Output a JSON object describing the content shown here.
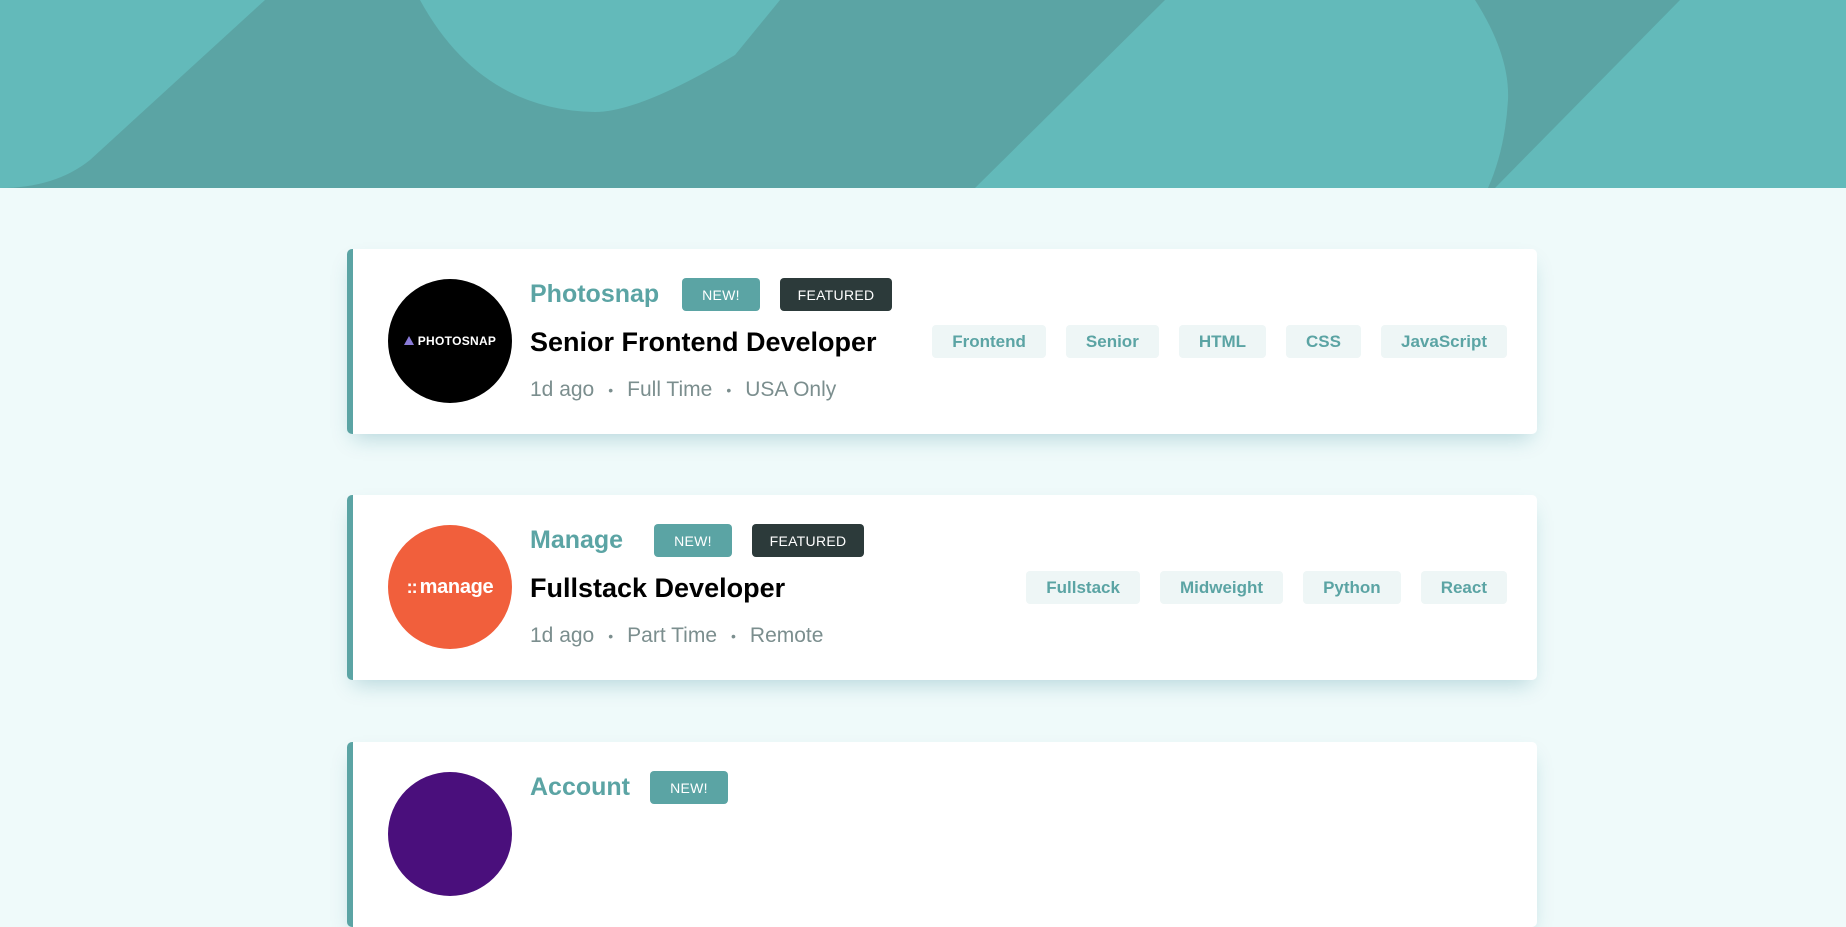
{
  "jobs": [
    {
      "company": "Photosnap",
      "logo_text": "PHOTOSNAP",
      "logo_color": "#000000",
      "new_label": "NEW!",
      "featured_label": "FEATURED",
      "position": "Senior Frontend Developer",
      "posted": "1d ago",
      "contract": "Full Time",
      "location": "USA Only",
      "tags": [
        "Frontend",
        "Senior",
        "HTML",
        "CSS",
        "JavaScript"
      ]
    },
    {
      "company": "Manage",
      "logo_text": "manage",
      "logo_color": "#f15f3c",
      "new_label": "NEW!",
      "featured_label": "FEATURED",
      "position": "Fullstack Developer",
      "posted": "1d ago",
      "contract": "Part Time",
      "location": "Remote",
      "tags": [
        "Fullstack",
        "Midweight",
        "Python",
        "React"
      ]
    },
    {
      "company": "Account",
      "logo_color": "#4a0f7c",
      "new_label": "NEW!"
    }
  ],
  "colors": {
    "primary": "#5ba4a4",
    "dark": "#2c3a3a",
    "background": "#effafa",
    "tag_bg": "#eef6f6"
  }
}
